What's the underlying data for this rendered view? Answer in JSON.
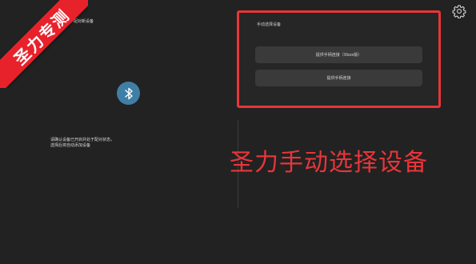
{
  "pairing": {
    "instruction": "在电脑设置中配对新设备",
    "hint_line1": "请确认设备已开启并处于配对状态，",
    "hint_line2": "选择后将自动添加设备"
  },
  "manual": {
    "title": "手动选择设备",
    "option_one": "提供手柄连接（Xbox版）",
    "option_two": "提供手柄连接"
  },
  "caption": "圣力手动选择设备",
  "ribbon": "圣力专测",
  "icons": {
    "bluetooth": "bluetooth-icon",
    "settings": "gear-icon"
  },
  "colors": {
    "highlight_red": "#e8353a",
    "bluetooth_blue": "#3f7fa6",
    "background": "#222222"
  }
}
